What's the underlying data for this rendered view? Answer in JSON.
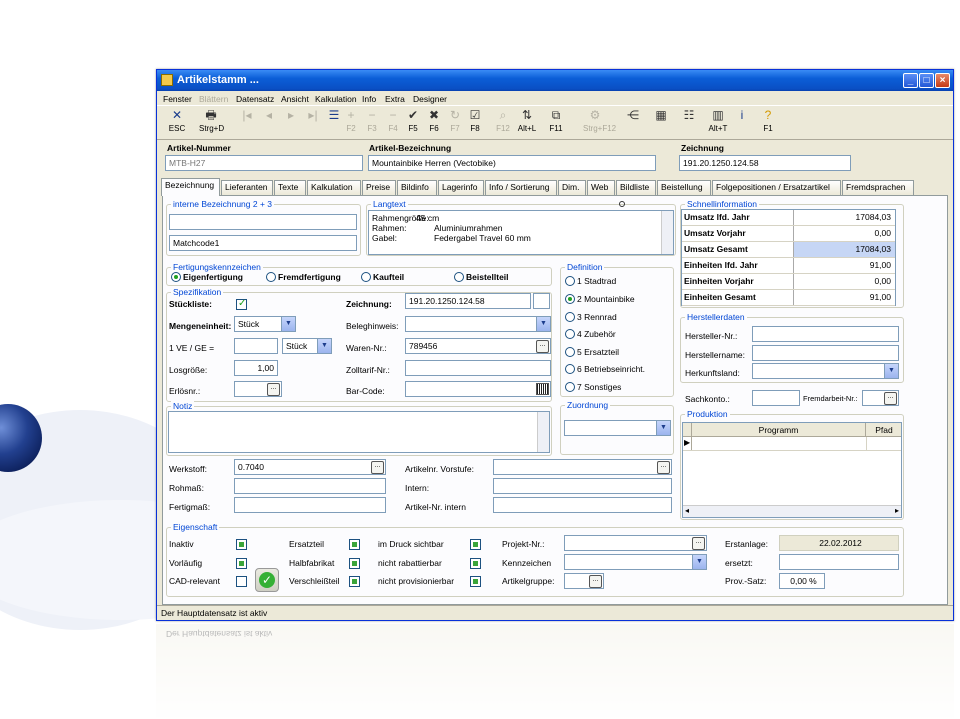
{
  "window": {
    "title": "Artikelstamm ..."
  },
  "menu": [
    "Fenster",
    "Blättern",
    "Datensatz",
    "Ansicht",
    "Kalkulation",
    "Info",
    "Extra",
    "Designer"
  ],
  "toolbar": {
    "esc": "ESC",
    "print": "Strg+D",
    "f2": "F2",
    "f3": "F3",
    "f4": "F4",
    "f5": "F5",
    "f6": "F6",
    "f7": "F7",
    "f8": "F8",
    "f12": "F12",
    "altl": "Alt+L",
    "f11": "F11",
    "strgf12": "Strg+F12",
    "altt": "Alt+T",
    "f1": "F1",
    "help": "?",
    "info": "i"
  },
  "header": {
    "artnr_label": "Artikel-Nummer",
    "artnr_value": "MTB-H27",
    "bez_label": "Artikel-Bezeichnung",
    "bez_value": "Mountainbike Herren (Vectobike)",
    "zeich_label": "Zeichnung",
    "zeich_value": "191.20.1250.124.58"
  },
  "tabs": [
    "Bezeichnung",
    "Lieferanten",
    "Texte",
    "Kalkulation",
    "Preise",
    "Bildinfo",
    "Lagerinfo",
    "Info / Sortierung",
    "Dim.",
    "Web",
    "Bildliste",
    "Beistellung",
    "Folgepositionen / Ersatzartikel",
    "Fremdsprachen"
  ],
  "bezeichnung": {
    "group_title": "interne Bezeichnung 2 + 3",
    "line2": "",
    "matchcode": "Matchcode1"
  },
  "langtext": {
    "title": "Langtext",
    "lines": [
      {
        "k": "Rahmengröße:",
        "v": "45 cm"
      },
      {
        "k": "Rahmen:",
        "v": "Aluminiumrahmen"
      },
      {
        "k": "Gabel:",
        "v": "Federgabel Travel 60 mm"
      }
    ]
  },
  "fertigung": {
    "title": "Fertigungskennzeichen",
    "options": [
      "Eigenfertigung",
      "Fremdfertigung",
      "Kaufteil",
      "Beistellteil"
    ]
  },
  "spezifikation": {
    "title": "Spezifikation",
    "stueckliste": "Stückliste:",
    "mengeneinheit_label": "Mengeneinheit:",
    "mengeneinheit": "Stück",
    "ve_label": "1 VE / GE =",
    "ve_unit": "Stück",
    "losgroesse_label": "Losgröße:",
    "losgroesse": "1,00",
    "erloesnr_label": "Erlösnr.:",
    "zeichnung_label": "Zeichnung:",
    "zeichnung": "191.20.1250.124.58",
    "beleg_label": "Beleghinweis:",
    "waren_label": "Waren-Nr.:",
    "waren": "789456",
    "zoll_label": "Zolltarif-Nr.:",
    "barcode_label": "Bar-Code:",
    "dots": "..."
  },
  "definition": {
    "title": "Definition",
    "options": [
      "1 Stadtrad",
      "2 Mountainbike",
      "3 Rennrad",
      "4 Zubehör",
      "5 Ersatzteil",
      "6 Betriebseinricht.",
      "7 Sonstiges"
    ]
  },
  "zuordnung": {
    "title": "Zuordnung"
  },
  "notiz": {
    "title": "Notiz"
  },
  "werkstoff": {
    "werkstoff_label": "Werkstoff:",
    "werkstoff": "0.7040",
    "rohmass_label": "Rohmaß:",
    "fertigmass_label": "Fertigmaß:",
    "vorstufe_label": "Artikelnr. Vorstufe:",
    "intern_label": "Intern:",
    "artnr_intern_label": "Artikel-Nr. intern"
  },
  "schnell": {
    "title": "Schnellinformation",
    "rows": [
      {
        "k": "Umsatz lfd. Jahr",
        "v": "17084,03"
      },
      {
        "k": "Umsatz Vorjahr",
        "v": "0,00"
      },
      {
        "k": "Umsatz Gesamt",
        "v": "17084,03"
      },
      {
        "k": "Einheiten lfd. Jahr",
        "v": "91,00"
      },
      {
        "k": "Einheiten Vorjahr",
        "v": "0,00"
      },
      {
        "k": "Einheiten Gesamt",
        "v": "91,00"
      }
    ]
  },
  "hersteller": {
    "title": "Herstellerdaten",
    "nr_label": "Hersteller-Nr.:",
    "name_label": "Herstellername:",
    "land_label": "Herkunftsland:",
    "sachkonto_label": "Sachkonto.:",
    "fremdarbeit_label": "Fremdarbeit-Nr.:"
  },
  "produktion": {
    "title": "Produktion",
    "col1": "Programm",
    "col2": "Pfad"
  },
  "eigenschaft": {
    "title": "Eigenschaft",
    "inaktiv": "Inaktiv",
    "vorlaeufig": "Vorläufig",
    "cad": "CAD-relevant",
    "ersatzteil": "Ersatzteil",
    "halbfabrikat": "Halbfabrikat",
    "verschleiss": "Verschleißteil",
    "druck": "im Druck sichtbar",
    "rabatt": "nicht rabattierbar",
    "provision": "nicht provisionierbar",
    "projekt": "Projekt-Nr.:",
    "kennzeichen": "Kennzeichen",
    "artgruppe": "Artikelgruppe:",
    "erstanlage_label": "Erstanlage:",
    "erstanlage": "22.02.2012",
    "ersetzt_label": "ersetzt:",
    "prov_label": "Prov.-Satz:",
    "prov": "0,00 %"
  },
  "status": {
    "text": "Der Hauptdatensatz ist aktiv"
  },
  "colors": {
    "titlebar": "#0a4fc4",
    "group_title": "#0046d5",
    "highlight": "#c6d6f5",
    "check": "#3aa53a"
  }
}
